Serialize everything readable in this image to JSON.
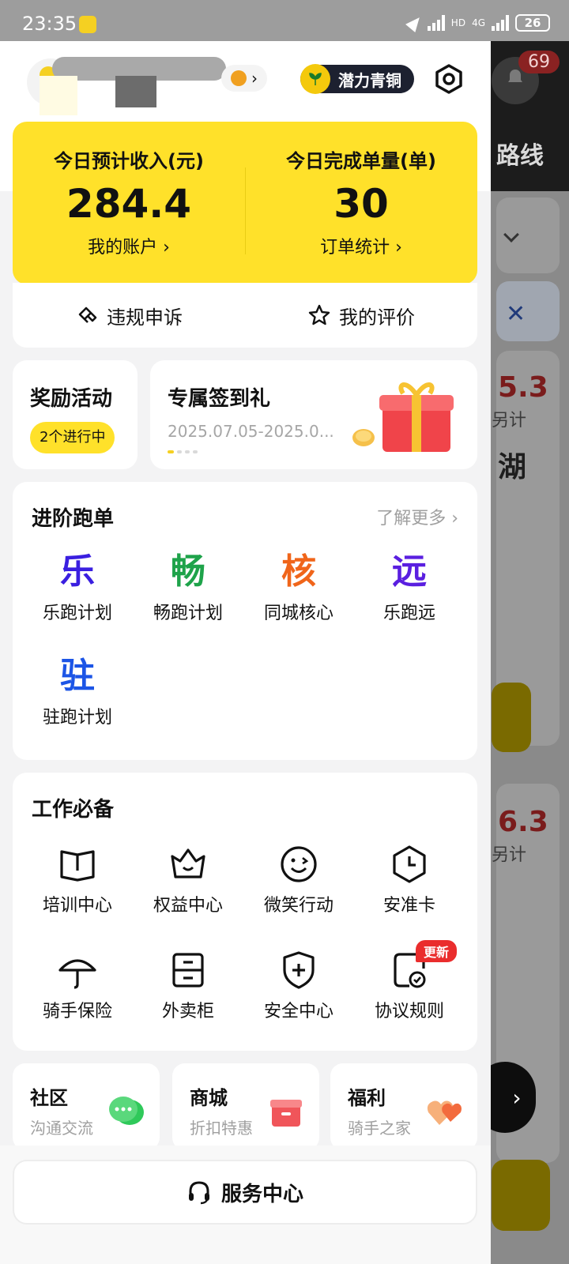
{
  "status_bar": {
    "time": "23:35",
    "battery": "26",
    "network": "4G",
    "hd_label": "HD"
  },
  "background_app": {
    "route_label": "路线",
    "notification_count": "69",
    "amount_1": "5.3",
    "amount_2": "6.3",
    "sub_1": "另计",
    "sub_2": "另计",
    "partial_text": "湖"
  },
  "header": {
    "tier_badge": "潜力青铜"
  },
  "income": {
    "left_label": "今日预计收入(元)",
    "left_value": "284.4",
    "left_link": "我的账户 ›",
    "right_label": "今日完成单量(单)",
    "right_value": "30",
    "right_link": "订单统计 ›"
  },
  "actions": {
    "appeal": "违规申诉",
    "rating": "我的评价"
  },
  "reward": {
    "title": "奖励活动",
    "pill": "2个进行中"
  },
  "signin": {
    "title": "专属签到礼",
    "date": "2025.07.05-2025.0..."
  },
  "advanced": {
    "title": "进阶跑单",
    "more": "了解更多 ›",
    "items": [
      {
        "glyph": "乐",
        "label": "乐跑计划",
        "color": "#3a1fe0"
      },
      {
        "glyph": "畅",
        "label": "畅跑计划",
        "color": "#1ea34a"
      },
      {
        "glyph": "核",
        "label": "同城核心",
        "color": "#f0651a"
      },
      {
        "glyph": "远",
        "label": "乐跑远",
        "color": "#5a1fe0"
      },
      {
        "glyph": "驻",
        "label": "驻跑计划",
        "color": "#1c55e6"
      }
    ]
  },
  "work": {
    "title": "工作必备",
    "items": [
      {
        "label": "培训中心",
        "icon": "book-icon"
      },
      {
        "label": "权益中心",
        "icon": "crown-icon"
      },
      {
        "label": "微笑行动",
        "icon": "smile-icon"
      },
      {
        "label": "安准卡",
        "icon": "clock-icon"
      },
      {
        "label": "骑手保险",
        "icon": "umbrella-icon"
      },
      {
        "label": "外卖柜",
        "icon": "locker-icon"
      },
      {
        "label": "安全中心",
        "icon": "shield-plus-icon"
      },
      {
        "label": "协议规则",
        "icon": "document-check-icon",
        "badge": "更新"
      }
    ]
  },
  "bottom_cards": [
    {
      "title": "社区",
      "sub": "沟通交流"
    },
    {
      "title": "商城",
      "sub": "折扣特惠"
    },
    {
      "title": "福利",
      "sub": "骑手之家"
    }
  ],
  "service": {
    "label": "服务中心"
  },
  "colors": {
    "accent": "#ffe12a",
    "tier_bg": "#1d2130",
    "badge_red": "#ea2d2d"
  }
}
